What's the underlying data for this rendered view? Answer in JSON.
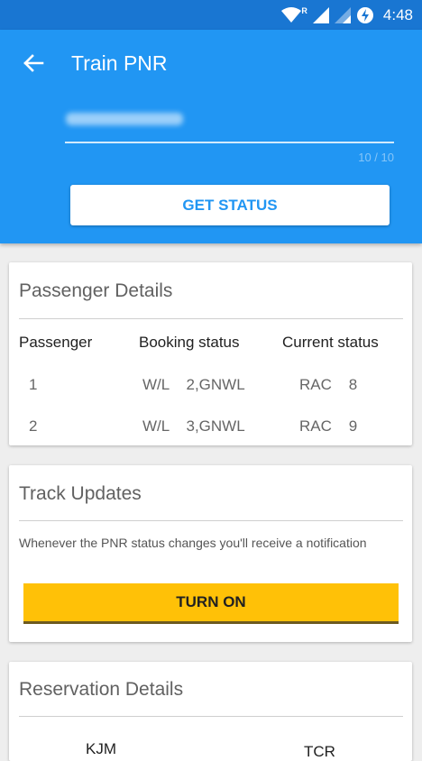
{
  "statusbar": {
    "time": "4:48",
    "roaming": "R"
  },
  "header": {
    "title": "Train PNR",
    "pnr_counter": "10 / 10",
    "get_status": "GET STATUS"
  },
  "passenger_details": {
    "title": "Passenger Details",
    "columns": [
      "Passenger",
      "Booking status",
      "Current status"
    ],
    "rows": [
      {
        "passenger": "1",
        "booking": "W/L    2,GNWL",
        "current": "RAC    8"
      },
      {
        "passenger": "2",
        "booking": "W/L    3,GNWL",
        "current": "RAC    9"
      }
    ]
  },
  "track_updates": {
    "title": "Track Updates",
    "note": "Whenever the PNR status changes you'll receive a notification",
    "turn_on": "TURN ON"
  },
  "reservation_details": {
    "title": "Reservation Details",
    "from_code": "KJM",
    "to_code": "TCR"
  },
  "colors": {
    "primary": "#2196f3",
    "primary_dark": "#1976d2",
    "accent": "#ffc107"
  }
}
